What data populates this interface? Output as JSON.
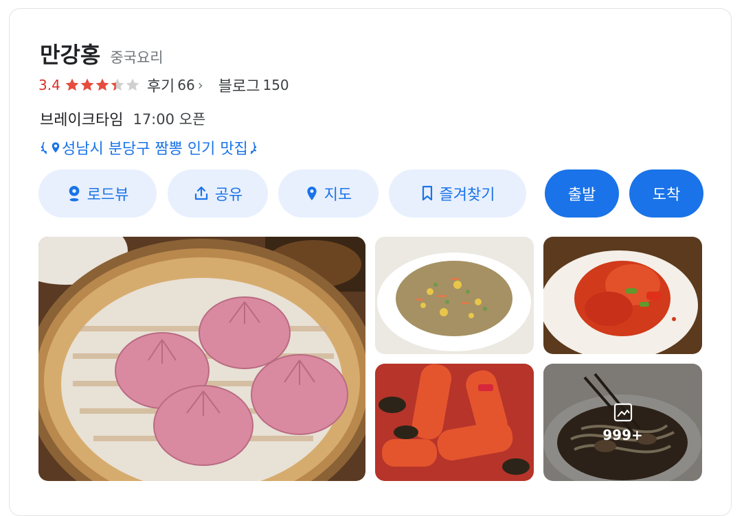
{
  "place": {
    "name": "만강홍",
    "category": "중국요리",
    "rating": "3.4",
    "rating_value": 3.4,
    "rating_max": 5,
    "reviews_label": "후기",
    "reviews_count": "66",
    "blog_label": "블로그",
    "blog_count": "150",
    "status": "브레이크타임",
    "status_time": "17:00 오픈",
    "badge": "성남시 분당구 짬뽕 인기 맛집"
  },
  "actions": {
    "roadview": "로드뷰",
    "share": "공유",
    "map": "지도",
    "bookmark": "즐겨찾기",
    "depart": "출발",
    "arrive": "도착"
  },
  "photos": {
    "more_count": "999+",
    "items": [
      "xiaolongbao",
      "fried-rice",
      "chili-shrimp",
      "sweet-sour-pork",
      "noodles"
    ]
  },
  "colors": {
    "accent": "#1a73e8",
    "accent_light": "#e8f0fe",
    "star": "#e74c3c",
    "rating": "#d93025"
  }
}
